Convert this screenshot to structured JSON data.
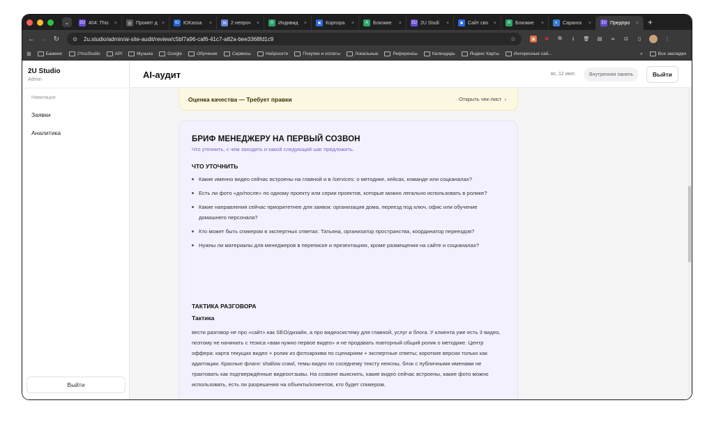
{
  "browser": {
    "tabs": [
      {
        "label": "404: This",
        "color": "#6b4bd6",
        "glyph": "2U"
      },
      {
        "label": "Промпт д",
        "color": "#555555",
        "glyph": "◎"
      },
      {
        "label": "ЮKassa",
        "color": "#1e64d8",
        "glyph": "Ю"
      },
      {
        "label": "2 непроч",
        "color": "#6a7fd8",
        "glyph": "✉"
      },
      {
        "label": "Индивид",
        "color": "#2aa56b",
        "glyph": "A"
      },
      {
        "label": "Корпора",
        "color": "#2a6be0",
        "glyph": "✖"
      },
      {
        "label": "Близкие",
        "color": "#2aa56b",
        "glyph": "A"
      },
      {
        "label": "2U Studi",
        "color": "#6b4bd6",
        "glyph": "2U"
      },
      {
        "label": "Сайт сво",
        "color": "#2a6be0",
        "glyph": "✖"
      },
      {
        "label": "Близкие",
        "color": "#2aa56b",
        "glyph": "A"
      },
      {
        "label": "Саранск",
        "color": "#3a7bd5",
        "glyph": "◐"
      },
      {
        "label": "Предпро",
        "color": "#6b4bd6",
        "glyph": "2U",
        "active": true
      }
    ],
    "url": "2u.studio/admin/ai-site-audit/review/c5bf7a96-caf6-41c7-a82a-bee3368fd1c9",
    "bookmarks": [
      "Банкинг",
      "2YouStudio",
      "API",
      "Музыка",
      "Google",
      "Обучение",
      "Сервисы",
      "Нейросети",
      "Покупки и оплаты",
      "Локальные",
      "Референсы",
      "Календарь",
      "Яндекс Карты",
      "Интересные сай..."
    ],
    "bookmarks_more": "»",
    "all_bookmarks": "Все закладки"
  },
  "sidebar": {
    "brand": "2U Studio",
    "role": "Admin",
    "nav_label": "Навигация",
    "items": [
      "Заявки",
      "Аналитика"
    ],
    "logout": "Выйти"
  },
  "header": {
    "title": "AI-аудит",
    "date": "вс, 12 июл.",
    "internal": "Внутренняя панель",
    "logout": "Выйти"
  },
  "quality": {
    "title": "Оценка качества — Требует правки",
    "link": "Открыть чек-лист"
  },
  "brief": {
    "title": "БРИФ МЕНЕДЖЕРУ НА ПЕРВЫЙ СОЗВОН",
    "subtitle": "Что уточнить, с чем заходить и какой следующий шаг предложить.",
    "clarify_title": "ЧТО УТОЧНИТЬ",
    "bullets": [
      "Какие именно видео сейчас встроены на главной и в /services: о методике, кейсах, команде или соцканалах?",
      "Есть ли фото «до/после» по одному проекту или серии проектов, которые можно легально использовать в ролике?",
      "Какие направления сейчас приоритетнее для заявок: организация дома, переезд под ключ, офис или обучение домашнего персонала?",
      "Кто может быть спикером в экспертных ответах: Татьяна, организатор пространства, координатор переездов?",
      "Нужны ли материалы для менеджеров в переписке и презентациях, кроме размещения на сайте и соцканалах?"
    ],
    "tactics_title": "ТАКТИКА РАЗГОВОРА",
    "tactics_sub": "Тактика",
    "tactics_text": "вести разговор не про «сайт» как SEO/дизайн, а про видеосистему для главной, услуг и блога. У клиента уже есть 3 видео, поэтому не начинать с тезиса «вам нужно первое видео» и не продавать повторный общий ролик о методике. Центр оффера: карта текущих видео + ролик из фотоархива по сценариям + экспертные ответы; короткие версии только как адаптации. Красные флаги: shallow crawl, темы видео по соседнему тексту неясны, блок с публичными именами не трактовать как подтверждённые видеоотзывы. На созвоне выяснить, какие видео сейчас встроены, какие фото можно использовать, есть ли разрешения на объекты/клиентов, кто будет спикером."
  },
  "colors": {
    "accent": "#7a5fc4",
    "card_bg": "#f3f1fd",
    "warning_bg": "#fdf8e1"
  }
}
